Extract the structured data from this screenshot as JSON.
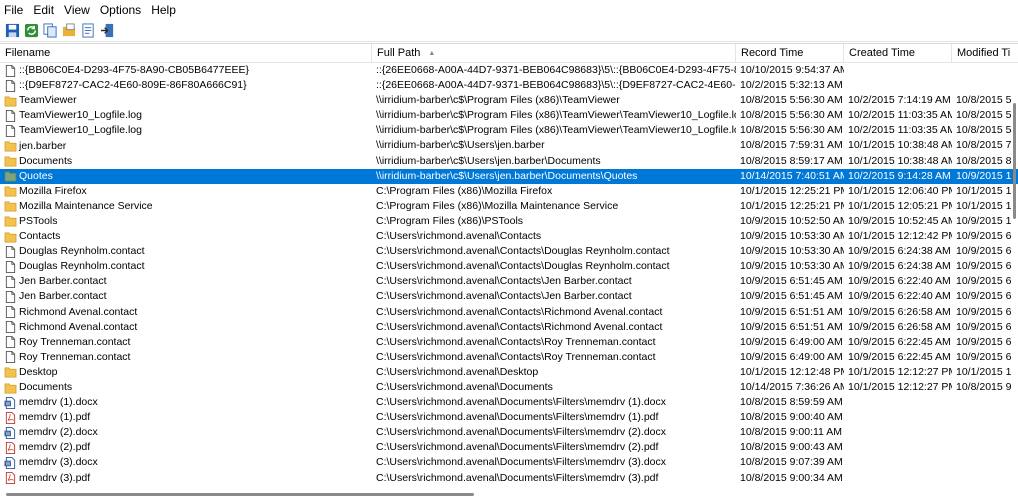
{
  "menu": [
    "File",
    "Edit",
    "View",
    "Options",
    "Help"
  ],
  "toolbar": [
    "save-icon",
    "refresh-icon",
    "copy-icon",
    "open-folder-icon",
    "properties-icon",
    "exit-icon"
  ],
  "columns": {
    "filename": "Filename",
    "full_path": "Full Path",
    "record_time": "Record Time",
    "created_time": "Created Time",
    "modified_time": "Modified Ti"
  },
  "rows": [
    {
      "icon": "file",
      "name": "::{BB06C0E4-D293-4F75-8A90-CB05B6477EEE}",
      "path": "::{26EE0668-A00A-44D7-9371-BEB064C98683}\\5\\::{BB06C0E4-D293-4F75-8A90-CB0...",
      "record": "10/10/2015 9:54:37 AM",
      "created": "",
      "modified": ""
    },
    {
      "icon": "file",
      "name": "::{D9EF8727-CAC2-4E60-809E-86F80A666C91}",
      "path": "::{26EE0668-A00A-44D7-9371-BEB064C98683}\\5\\::{D9EF8727-CAC2-4E60-809E-86F8...",
      "record": "10/2/2015 5:32:13 AM",
      "created": "",
      "modified": ""
    },
    {
      "icon": "folder",
      "name": "TeamViewer",
      "path": "\\\\irridium-barber\\c$\\Program Files (x86)\\TeamViewer",
      "record": "10/8/2015 5:56:30 AM",
      "created": "10/2/2015 7:14:19 AM",
      "modified": "10/8/2015 5"
    },
    {
      "icon": "file",
      "name": "TeamViewer10_Logfile.log",
      "path": "\\\\irridium-barber\\c$\\Program Files (x86)\\TeamViewer\\TeamViewer10_Logfile.log",
      "record": "10/8/2015 5:56:30 AM",
      "created": "10/2/2015 11:03:35 AM",
      "modified": "10/8/2015 5"
    },
    {
      "icon": "file",
      "name": "TeamViewer10_Logfile.log",
      "path": "\\\\irridium-barber\\c$\\Program Files (x86)\\TeamViewer\\TeamViewer10_Logfile.log",
      "record": "10/8/2015 5:56:30 AM",
      "created": "10/2/2015 11:03:35 AM",
      "modified": "10/8/2015 5"
    },
    {
      "icon": "folder",
      "name": "jen.barber",
      "path": "\\\\irridium-barber\\c$\\Users\\jen.barber",
      "record": "10/8/2015 7:59:31 AM",
      "created": "10/1/2015 10:38:48 AM",
      "modified": "10/8/2015 7"
    },
    {
      "icon": "folder",
      "name": "Documents",
      "path": "\\\\irridium-barber\\c$\\Users\\jen.barber\\Documents",
      "record": "10/8/2015 8:59:17 AM",
      "created": "10/1/2015 10:38:48 AM",
      "modified": "10/8/2015 8"
    },
    {
      "icon": "folder-selected",
      "name": "Quotes",
      "path": "\\\\irridium-barber\\c$\\Users\\jen.barber\\Documents\\Quotes",
      "record": "10/14/2015 7:40:51 AM",
      "created": "10/2/2015 9:14:28 AM",
      "modified": "10/9/2015 1",
      "selected": true
    },
    {
      "icon": "folder",
      "name": "Mozilla Firefox",
      "path": "C:\\Program Files (x86)\\Mozilla Firefox",
      "record": "10/1/2015 12:25:21 PM",
      "created": "10/1/2015 12:06:40 PM",
      "modified": "10/1/2015 1"
    },
    {
      "icon": "folder",
      "name": "Mozilla Maintenance Service",
      "path": "C:\\Program Files (x86)\\Mozilla Maintenance Service",
      "record": "10/1/2015 12:25:21 PM",
      "created": "10/1/2015 12:05:21 PM",
      "modified": "10/1/2015 1"
    },
    {
      "icon": "folder",
      "name": "PSTools",
      "path": "C:\\Program Files (x86)\\PSTools",
      "record": "10/9/2015 10:52:50 AM",
      "created": "10/9/2015 10:52:45 AM",
      "modified": "10/9/2015 1"
    },
    {
      "icon": "folder",
      "name": "Contacts",
      "path": "C:\\Users\\richmond.avenal\\Contacts",
      "record": "10/9/2015 10:53:30 AM",
      "created": "10/1/2015 12:12:42 PM",
      "modified": "10/9/2015 6"
    },
    {
      "icon": "file",
      "name": "Douglas Reynholm.contact",
      "path": "C:\\Users\\richmond.avenal\\Contacts\\Douglas Reynholm.contact",
      "record": "10/9/2015 10:53:30 AM",
      "created": "10/9/2015 6:24:38 AM",
      "modified": "10/9/2015 6"
    },
    {
      "icon": "file",
      "name": "Douglas Reynholm.contact",
      "path": "C:\\Users\\richmond.avenal\\Contacts\\Douglas Reynholm.contact",
      "record": "10/9/2015 10:53:30 AM",
      "created": "10/9/2015 6:24:38 AM",
      "modified": "10/9/2015 6"
    },
    {
      "icon": "file",
      "name": "Jen Barber.contact",
      "path": "C:\\Users\\richmond.avenal\\Contacts\\Jen Barber.contact",
      "record": "10/9/2015 6:51:45 AM",
      "created": "10/9/2015 6:22:40 AM",
      "modified": "10/9/2015 6"
    },
    {
      "icon": "file",
      "name": "Jen Barber.contact",
      "path": "C:\\Users\\richmond.avenal\\Contacts\\Jen Barber.contact",
      "record": "10/9/2015 6:51:45 AM",
      "created": "10/9/2015 6:22:40 AM",
      "modified": "10/9/2015 6"
    },
    {
      "icon": "file",
      "name": "Richmond Avenal.contact",
      "path": "C:\\Users\\richmond.avenal\\Contacts\\Richmond Avenal.contact",
      "record": "10/9/2015 6:51:51 AM",
      "created": "10/9/2015 6:26:58 AM",
      "modified": "10/9/2015 6"
    },
    {
      "icon": "file",
      "name": "Richmond Avenal.contact",
      "path": "C:\\Users\\richmond.avenal\\Contacts\\Richmond Avenal.contact",
      "record": "10/9/2015 6:51:51 AM",
      "created": "10/9/2015 6:26:58 AM",
      "modified": "10/9/2015 6"
    },
    {
      "icon": "file",
      "name": "Roy Trenneman.contact",
      "path": "C:\\Users\\richmond.avenal\\Contacts\\Roy Trenneman.contact",
      "record": "10/9/2015 6:49:00 AM",
      "created": "10/9/2015 6:22:45 AM",
      "modified": "10/9/2015 6"
    },
    {
      "icon": "file",
      "name": "Roy Trenneman.contact",
      "path": "C:\\Users\\richmond.avenal\\Contacts\\Roy Trenneman.contact",
      "record": "10/9/2015 6:49:00 AM",
      "created": "10/9/2015 6:22:45 AM",
      "modified": "10/9/2015 6"
    },
    {
      "icon": "folder",
      "name": "Desktop",
      "path": "C:\\Users\\richmond.avenal\\Desktop",
      "record": "10/1/2015 12:12:48 PM",
      "created": "10/1/2015 12:12:27 PM",
      "modified": "10/1/2015 1"
    },
    {
      "icon": "folder",
      "name": "Documents",
      "path": "C:\\Users\\richmond.avenal\\Documents",
      "record": "10/14/2015 7:36:26 AM",
      "created": "10/1/2015 12:12:27 PM",
      "modified": "10/8/2015 9"
    },
    {
      "icon": "word",
      "name": "memdrv (1).docx",
      "path": "C:\\Users\\richmond.avenal\\Documents\\Filters\\memdrv (1).docx",
      "record": "10/8/2015 8:59:59 AM",
      "created": "",
      "modified": ""
    },
    {
      "icon": "pdf",
      "name": "memdrv (1).pdf",
      "path": "C:\\Users\\richmond.avenal\\Documents\\Filters\\memdrv (1).pdf",
      "record": "10/8/2015 9:00:40 AM",
      "created": "",
      "modified": ""
    },
    {
      "icon": "word",
      "name": "memdrv (2).docx",
      "path": "C:\\Users\\richmond.avenal\\Documents\\Filters\\memdrv (2).docx",
      "record": "10/8/2015 9:00:11 AM",
      "created": "",
      "modified": ""
    },
    {
      "icon": "pdf",
      "name": "memdrv (2).pdf",
      "path": "C:\\Users\\richmond.avenal\\Documents\\Filters\\memdrv (2).pdf",
      "record": "10/8/2015 9:00:43 AM",
      "created": "",
      "modified": ""
    },
    {
      "icon": "word",
      "name": "memdrv (3).docx",
      "path": "C:\\Users\\richmond.avenal\\Documents\\Filters\\memdrv (3).docx",
      "record": "10/8/2015 9:07:39 AM",
      "created": "",
      "modified": ""
    },
    {
      "icon": "pdf",
      "name": "memdrv (3).pdf",
      "path": "C:\\Users\\richmond.avenal\\Documents\\Filters\\memdrv (3).pdf",
      "record": "10/8/2015 9:00:34 AM",
      "created": "",
      "modified": ""
    }
  ]
}
